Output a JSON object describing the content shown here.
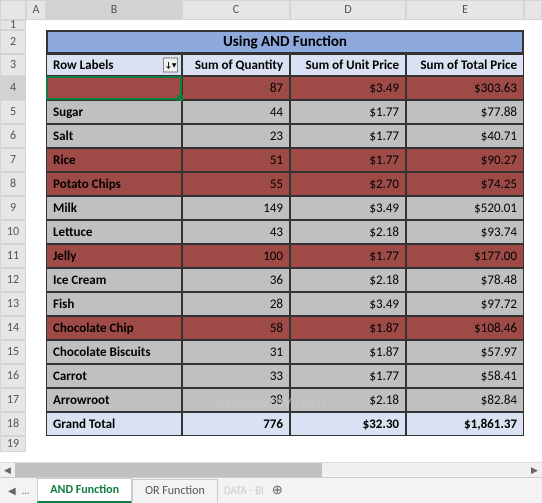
{
  "columns": [
    "A",
    "B",
    "C",
    "D",
    "E"
  ],
  "rows": [
    "1",
    "2",
    "3",
    "4",
    "5",
    "6",
    "7",
    "8",
    "9",
    "10",
    "11",
    "12",
    "13",
    "14",
    "15",
    "16",
    "17",
    "18",
    "19"
  ],
  "title": "Using AND Function",
  "headers": {
    "row_labels": "Row Labels",
    "qty": "Sum of Quantity",
    "unit": "Sum of Unit Price",
    "total": "Sum of Total Price"
  },
  "data": [
    {
      "label": "",
      "qty": "87",
      "unit": "$3.49",
      "total": "$303.63",
      "hl": true
    },
    {
      "label": "Sugar",
      "qty": "44",
      "unit": "$1.77",
      "total": "$77.88",
      "hl": false
    },
    {
      "label": "Salt",
      "qty": "23",
      "unit": "$1.77",
      "total": "$40.71",
      "hl": false
    },
    {
      "label": "Rice",
      "qty": "51",
      "unit": "$1.77",
      "total": "$90.27",
      "hl": true
    },
    {
      "label": "Potato Chips",
      "qty": "55",
      "unit": "$2.70",
      "total": "$74.25",
      "hl": true
    },
    {
      "label": "Milk",
      "qty": "149",
      "unit": "$3.49",
      "total": "$520.01",
      "hl": false
    },
    {
      "label": "Lettuce",
      "qty": "43",
      "unit": "$2.18",
      "total": "$93.74",
      "hl": false
    },
    {
      "label": "Jelly",
      "qty": "100",
      "unit": "$1.77",
      "total": "$177.00",
      "hl": true
    },
    {
      "label": "Ice Cream",
      "qty": "36",
      "unit": "$2.18",
      "total": "$78.48",
      "hl": false
    },
    {
      "label": "Fish",
      "qty": "28",
      "unit": "$3.49",
      "total": "$97.72",
      "hl": false
    },
    {
      "label": "Chocolate Chip",
      "qty": "58",
      "unit": "$1.87",
      "total": "$108.46",
      "hl": true
    },
    {
      "label": "Chocolate Biscuits",
      "qty": "31",
      "unit": "$1.87",
      "total": "$57.97",
      "hl": false
    },
    {
      "label": "Carrot",
      "qty": "33",
      "unit": "$1.77",
      "total": "$58.41",
      "hl": false
    },
    {
      "label": "Arrowroot",
      "qty": "38",
      "unit": "$2.18",
      "total": "$82.84",
      "hl": false
    }
  ],
  "grand_total": {
    "label": "Grand Total",
    "qty": "776",
    "unit": "$32.30",
    "total": "$1,861.37"
  },
  "watermark": "exceldemy.com",
  "tabs": {
    "active": "AND Function",
    "inactive": "OR Function",
    "faded": "DATA - BI"
  },
  "icons": {
    "filter": "↓▾",
    "ellipsis": "...",
    "plus": "⊕",
    "left": "◀",
    "right": "▶"
  },
  "chart_data": {
    "type": "table",
    "title": "Using AND Function",
    "columns": [
      "Row Labels",
      "Sum of Quantity",
      "Sum of Unit Price",
      "Sum of Total Price"
    ],
    "rows": [
      [
        "",
        87,
        3.49,
        303.63
      ],
      [
        "Sugar",
        44,
        1.77,
        77.88
      ],
      [
        "Salt",
        23,
        1.77,
        40.71
      ],
      [
        "Rice",
        51,
        1.77,
        90.27
      ],
      [
        "Potato Chips",
        55,
        2.7,
        74.25
      ],
      [
        "Milk",
        149,
        3.49,
        520.01
      ],
      [
        "Lettuce",
        43,
        2.18,
        93.74
      ],
      [
        "Jelly",
        100,
        1.77,
        177.0
      ],
      [
        "Ice Cream",
        36,
        2.18,
        78.48
      ],
      [
        "Fish",
        28,
        3.49,
        97.72
      ],
      [
        "Chocolate Chip",
        58,
        1.87,
        108.46
      ],
      [
        "Chocolate Biscuits",
        31,
        1.87,
        57.97
      ],
      [
        "Carrot",
        33,
        1.77,
        58.41
      ],
      [
        "Arrowroot",
        38,
        2.18,
        82.84
      ]
    ],
    "totals": [
      "Grand Total",
      776,
      32.3,
      1861.37
    ],
    "highlighted_rows": [
      0,
      3,
      4,
      7,
      10
    ]
  }
}
